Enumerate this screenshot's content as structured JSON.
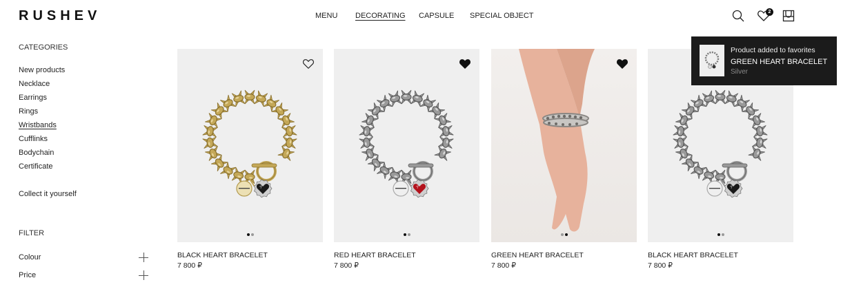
{
  "header": {
    "logo": "RUSHEV",
    "nav": [
      {
        "label": "MENU",
        "active": false
      },
      {
        "label": "DECORATING",
        "active": true
      },
      {
        "label": "CAPSULE",
        "active": false
      },
      {
        "label": "SPECIAL OBJECT",
        "active": false
      }
    ],
    "icons": [
      "search-icon",
      "heart-icon",
      "cart-icon"
    ],
    "favorites_count": "2"
  },
  "sidebar": {
    "categories_heading": "CATEGORIES",
    "categories": [
      {
        "label": "New products",
        "active": false
      },
      {
        "label": "Necklace",
        "active": false
      },
      {
        "label": "Earrings",
        "active": false
      },
      {
        "label": "Rings",
        "active": false
      },
      {
        "label": "Wristbands",
        "active": true
      },
      {
        "label": "Cufflinks",
        "active": false
      },
      {
        "label": "Bodychain",
        "active": false
      },
      {
        "label": "Certificate",
        "active": false
      }
    ],
    "collect": "Collect it yourself",
    "filter_heading": "FILTER",
    "filters": [
      {
        "label": "Colour"
      },
      {
        "label": "Price"
      }
    ]
  },
  "products": [
    {
      "name": "BLACK HEART BRACELET",
      "price": "7 800 ₽",
      "favorited": false,
      "metal": "gold",
      "stone": "black",
      "slides": 2,
      "active_slide": 0
    },
    {
      "name": "RED HEART BRACELET",
      "price": "7 800 ₽",
      "favorited": true,
      "metal": "silver",
      "stone": "red",
      "slides": 2,
      "active_slide": 0
    },
    {
      "name": "GREEN HEART BRACELET",
      "price": "7 800 ₽",
      "favorited": true,
      "metal": "silver",
      "stone": "none",
      "slides": 2,
      "active_slide": 1
    },
    {
      "name": "BLACK HEART BRACELET",
      "price": "7 800 ₽",
      "favorited": false,
      "metal": "silver",
      "stone": "black",
      "slides": 2,
      "active_slide": 0
    }
  ],
  "toast": {
    "title": "Product added to favorites",
    "product": "GREEN HEART BRACELET",
    "variant": "Silver"
  },
  "colors": {
    "gold": "#c4a858",
    "silver": "#9a9a9a",
    "red_stone": "#b3121c",
    "black_stone": "#1a1a1a",
    "toast_bg": "#1b1b1b"
  }
}
